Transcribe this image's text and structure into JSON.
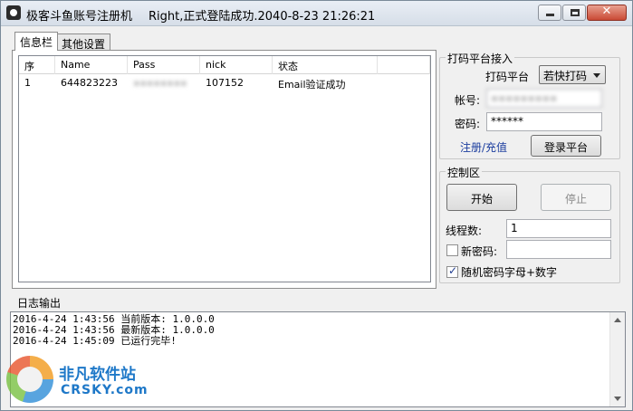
{
  "window": {
    "title": "极客斗鱼账号注册机",
    "status": "Right,正式登陆成功.2040-8-23 21:26:21",
    "close_glyph": "✕"
  },
  "tabs": [
    {
      "label": "信息栏",
      "active": true
    },
    {
      "label": "其他设置",
      "active": false
    }
  ],
  "table": {
    "columns": [
      "序",
      "Name",
      "Pass",
      "nick",
      "状态"
    ],
    "rows": [
      {
        "index": "1",
        "name": "644823223",
        "pass": "▪▪▪▪▪▪▪▪",
        "nick": "107152",
        "status": "Email验证成功"
      }
    ]
  },
  "platform": {
    "group_title": "打码平台接入",
    "platform_label": "打码平台",
    "platform_value": "若快打码",
    "account_label": "帐号:",
    "account_value": "▪▪▪▪▪▪▪▪▪",
    "password_label": "密码:",
    "password_value": "******",
    "register_link": "注册/充值",
    "login_button": "登录平台"
  },
  "control": {
    "group_title": "控制区",
    "start_button": "开始",
    "stop_button": "停止",
    "threads_label": "线程数:",
    "threads_value": "1",
    "new_password_label": "新密码:",
    "new_password_value": "",
    "new_password_checked": false,
    "random_password_label": "随机密码字母+数字",
    "random_password_checked": true
  },
  "log": {
    "label": "日志输出",
    "lines": [
      "2016-4-24 1:43:56 当前版本: 1.0.0.0",
      "2016-4-24 1:43:56 最新版本: 1.0.0.0",
      "2016-4-24 1:45:09 已运行完毕!"
    ]
  },
  "watermark": {
    "cn": "非凡软件站",
    "en": "CRSKY.com"
  }
}
